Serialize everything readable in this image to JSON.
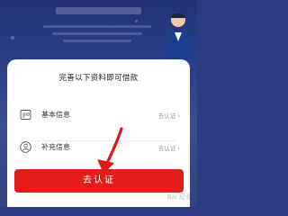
{
  "modal": {
    "title": "完善以下资料即可借款",
    "rows": [
      {
        "label": "基本信息",
        "action": "去认证",
        "icon": "id-card-icon"
      },
      {
        "label": "补充信息",
        "action": "去认证",
        "icon": "person-icon"
      }
    ],
    "cta_label": "去认证"
  },
  "watermark": "Bai 经验",
  "colors": {
    "background": "#2c3f8b",
    "cta": "#e61b1b",
    "arrow": "#e21818"
  }
}
